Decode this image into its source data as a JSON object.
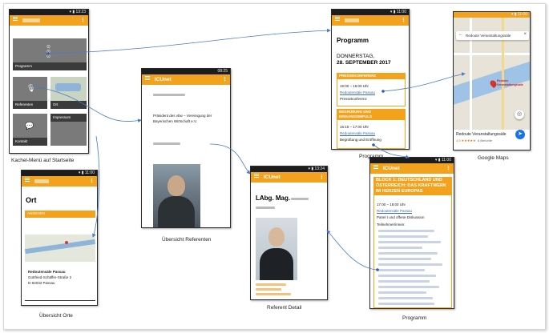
{
  "captions": {
    "kachel": "Kachel-Menü auf Startseite",
    "orte": "Übersicht Orte",
    "referenten": "Übersicht Referenten",
    "referent_detail": "Referent Detail",
    "programm1": "Programm",
    "programm2": "Programm",
    "maps": "Google Maps"
  },
  "app_name": "ICUnet",
  "kachel": {
    "tiles": [
      "Programm",
      "Referenten",
      "Ort",
      "Kontakt",
      "Impressum"
    ]
  },
  "orte": {
    "title": "Ort",
    "button": "ANSEHEN",
    "address": [
      "Redoutensäle Passau",
      "Gottfried-Schäffer-Straße 2",
      "D-94032 Passau"
    ]
  },
  "referenten": {
    "org": [
      "Präsident des vbw – Vereinigung der",
      "Bayerischen Wirtschaft e.V."
    ]
  },
  "detail": {
    "name": "LAbg. Mag."
  },
  "programm1": {
    "title": "Programm",
    "date": "DONNERSTAG,",
    "date2": "28. SEPTEMBER 2017",
    "section1": "PRESSEKONFERENZ",
    "time1": "15:00 – 16:00 Uhr",
    "loc1": "Redoutensäle Passau",
    "kind1": "Pressekonferenz",
    "section2": "BEGRÜßUNG UND EINGANGSIMPULS",
    "time2": "16:15 – 17:00 Uhr",
    "loc2": "Redoutensäle Passau",
    "kind2": "Begrüßung und Eröffnung"
  },
  "programm2": {
    "block": "BLOCK 1: DEUTSCHLAND UND ÖSTERREICH: DAS KRAFTWERK IM HERZEN EUROPAS",
    "time": "17:00 – 18:00 Uhr",
    "loc": "Redoutensäle Passau",
    "kind": "Panel I und offene Diskussion",
    "participants": "Teilnehmer/innen:"
  },
  "maps": {
    "search": "Redoute Veranstaltungssäle",
    "place": "Redoute Veranstaltungssäle",
    "pin_label": "Redoute Veranstaltungssäle",
    "rating": "4,5 ★★★★★",
    "reviews": "6 Berichte"
  },
  "time": "08:25",
  "colors": {
    "accent": "#f2a21c",
    "link": "#3a6fb5",
    "connector": "#4a7bc8"
  }
}
